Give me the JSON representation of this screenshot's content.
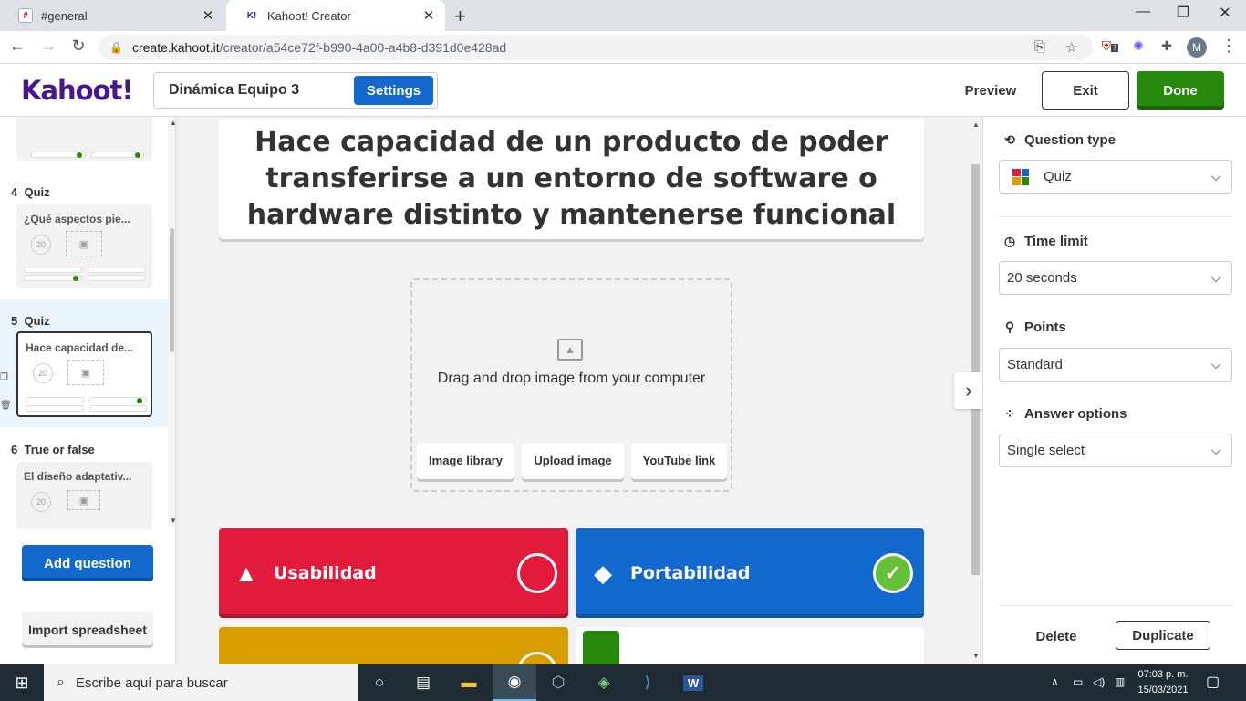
{
  "browser": {
    "tabs": [
      {
        "title": "#general",
        "active": false
      },
      {
        "title": "Kahoot! Creator",
        "active": true
      }
    ],
    "new_tab": "+",
    "url_host": "create.kahoot.it",
    "url_path": "/creator/a54ce72f-b990-4a00-a4b8-d391d0e428ad",
    "ext_badge": "7",
    "avatar_letter": "M"
  },
  "header": {
    "logo": "Kahoot!",
    "kahoot_title": "Dinámica Equipo 3",
    "settings_label": "Settings",
    "preview_label": "Preview",
    "exit_label": "Exit",
    "done_label": "Done"
  },
  "sidebar": {
    "slides": [
      {
        "number": "4",
        "type": "Quiz",
        "title": "¿Qué aspectos pie...",
        "timer": "20"
      },
      {
        "number": "5",
        "type": "Quiz",
        "title": "Hace capacidad de...",
        "timer": "20",
        "selected": true
      },
      {
        "number": "6",
        "type": "True or false",
        "title": "El diseño adaptativ...",
        "timer": "20"
      }
    ],
    "add_question_label": "Add question",
    "import_label": "Import spreadsheet"
  },
  "editor": {
    "question_text": "Hace capacidad de un producto de poder transferirse a un entorno de software o hardware distinto y mantenerse funcional",
    "media": {
      "drag_text": "Drag and drop image from your computer",
      "buttons": [
        "Image library",
        "Upload image",
        "YouTube link"
      ]
    },
    "answers": [
      {
        "text": "Usabilidad",
        "shape": "triangle-icon",
        "color": "#e21b3c",
        "correct": false
      },
      {
        "text": "Portabilidad",
        "shape": "diamond-icon",
        "color": "#1368ce",
        "correct": true
      },
      {
        "text": "",
        "shape": "circle-icon",
        "color": "#d89e00",
        "correct": false
      },
      {
        "text": "",
        "shape": "square-icon",
        "color": "#26890c",
        "correct": false
      }
    ]
  },
  "right_panel": {
    "question_type_label": "Question type",
    "question_type_value": "Quiz",
    "time_limit_label": "Time limit",
    "time_limit_value": "20 seconds",
    "points_label": "Points",
    "points_value": "Standard",
    "answer_options_label": "Answer options",
    "answer_options_value": "Single select",
    "delete_label": "Delete",
    "duplicate_label": "Duplicate"
  },
  "taskbar": {
    "search_placeholder": "Escribe aquí para buscar",
    "time": "07:03 p. m.",
    "date": "15/03/2021"
  },
  "colors": {
    "kahoot_purple": "#46178f",
    "blue": "#1368ce",
    "green": "#26890c",
    "red": "#e21b3c",
    "yellow": "#d89e00"
  }
}
